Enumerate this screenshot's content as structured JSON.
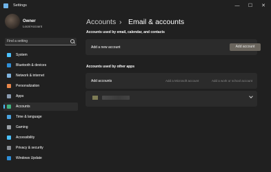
{
  "window": {
    "title": "Settings",
    "minimize": "—",
    "maximize": "☐",
    "close": "✕"
  },
  "user": {
    "name": "Owner",
    "account_type": "Local Account"
  },
  "search": {
    "placeholder": "Find a setting"
  },
  "nav": [
    {
      "label": "System",
      "icon": "system-icon",
      "color": "#4cc2ff"
    },
    {
      "label": "Bluetooth & devices",
      "icon": "bluetooth-icon",
      "color": "#2f8fd8"
    },
    {
      "label": "Network & internet",
      "icon": "network-icon",
      "color": "#7fb4e0"
    },
    {
      "label": "Personalization",
      "icon": "brush-icon",
      "color": "#e8874a"
    },
    {
      "label": "Apps",
      "icon": "apps-icon",
      "color": "#8a9bb0"
    },
    {
      "label": "Accounts",
      "icon": "accounts-icon",
      "color": "#3fb27f",
      "active": true
    },
    {
      "label": "Time & language",
      "icon": "clock-icon",
      "color": "#4aa3df"
    },
    {
      "label": "Gaming",
      "icon": "gaming-icon",
      "color": "#9aa0a6"
    },
    {
      "label": "Accessibility",
      "icon": "accessibility-icon",
      "color": "#4cc2ff"
    },
    {
      "label": "Privacy & security",
      "icon": "shield-icon",
      "color": "#8a8f96"
    },
    {
      "label": "Windows Update",
      "icon": "update-icon",
      "color": "#2f8fd8"
    }
  ],
  "breadcrumb": {
    "parent": "Accounts",
    "separator": "›",
    "current": "Email & accounts"
  },
  "section1": {
    "title": "Accounts used by email, calendar, and contacts",
    "row_label": "Add a new account",
    "button": "Add account"
  },
  "section2": {
    "title": "Accounts used by other apps",
    "row_label": "Add accounts",
    "link_microsoft": "Add a Microsoft account",
    "link_work": "Add a work or school account"
  }
}
